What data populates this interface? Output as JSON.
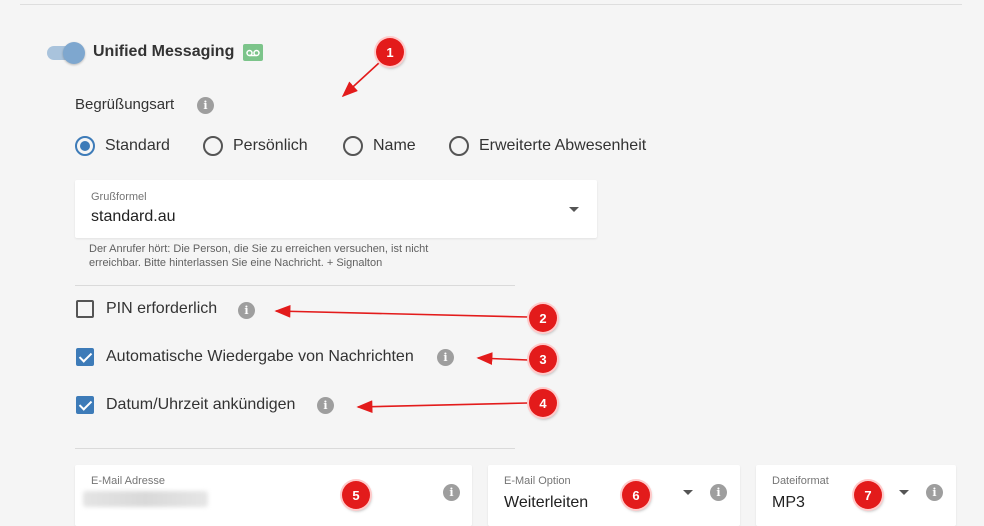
{
  "unified_messaging": {
    "title": "Unified Messaging",
    "enabled": true,
    "badge_icon": "voicemail-icon"
  },
  "greeting": {
    "label": "Begrüßungsart",
    "options": [
      {
        "label": "Standard",
        "checked": true
      },
      {
        "label": "Persönlich",
        "checked": false
      },
      {
        "label": "Name",
        "checked": false
      },
      {
        "label": "Erweiterte Abwesenheit",
        "checked": false
      }
    ]
  },
  "salutation": {
    "label": "Grußformel",
    "value": "standard.au",
    "hint": "Der Anrufer hört: Die Person, die Sie zu erreichen versuchen, ist nicht erreichbar. Bitte hinterlassen Sie eine Nachricht. + Signalton"
  },
  "options": {
    "pin_required": {
      "label": "PIN erforderlich",
      "checked": false
    },
    "autoplay": {
      "label": "Automatische Wiedergabe von Nachrichten",
      "checked": true
    },
    "announce_datetime": {
      "label": "Datum/Uhrzeit ankündigen",
      "checked": true
    }
  },
  "email": {
    "address_label": "E-Mail Adresse",
    "option_label": "E-Mail Option",
    "option_value": "Weiterleiten",
    "format_label": "Dateiformat",
    "format_value": "MP3"
  },
  "annotations": [
    "1",
    "2",
    "3",
    "4",
    "5",
    "6",
    "7"
  ],
  "colors": {
    "accent": "#3d7bb8",
    "annotation": "#e31b1b",
    "voicemail_badge": "#7cc48a"
  }
}
